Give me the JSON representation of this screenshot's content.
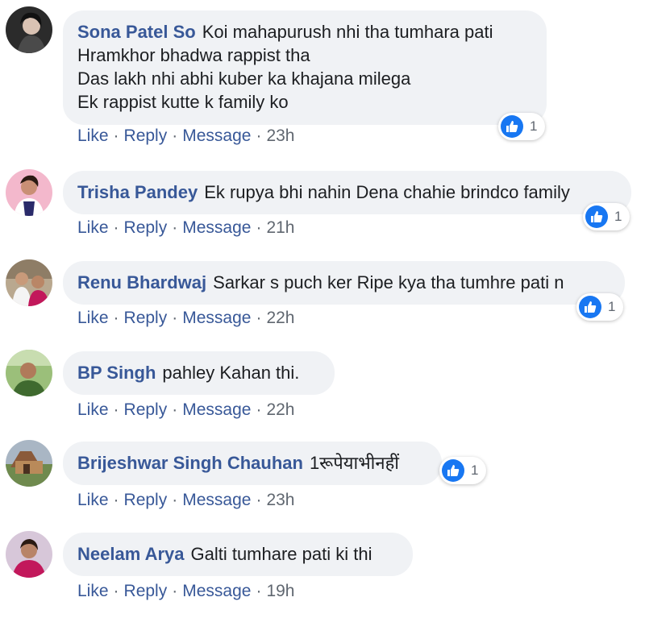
{
  "comments": [
    {
      "author": "Sona Patel So",
      "text": "Koi mahapurush nhi tha tumhara pati\nHramkhor bhadwa rappist tha\nDas lakh nhi abhi kuber ka khajana milega\nEk rappist kutte k family ko",
      "reaction_count": "1",
      "time": "23h"
    },
    {
      "author": "Trisha Pandey",
      "text": "Ek rupya bhi nahin Dena chahie brindco family",
      "reaction_count": "1",
      "time": "21h"
    },
    {
      "author": "Renu Bhardwaj",
      "text": "Sarkar s puch ker Ripe kya tha tumhre pati n",
      "reaction_count": "1",
      "time": "22h"
    },
    {
      "author": "BP Singh",
      "text": "pahley Kahan thi.",
      "time": "22h"
    },
    {
      "author": "Brijeshwar Singh Chauhan",
      "text": "1रूपेयाभीनहीं",
      "reaction_count": "1",
      "time": "23h"
    },
    {
      "author": "Neelam Arya",
      "text": "Galti tumhare pati ki thi",
      "time": "19h"
    }
  ],
  "actions": {
    "like": "Like",
    "reply": "Reply",
    "message": "Message",
    "separator": "·"
  },
  "colors": {
    "name_link": "#385898",
    "bubble_bg": "#f0f2f5",
    "like_blue": "#1877f2",
    "meta_gray": "#606770"
  },
  "icons": {
    "reaction": "like-thumbs-up-icon",
    "avatar": "profile-photo"
  }
}
